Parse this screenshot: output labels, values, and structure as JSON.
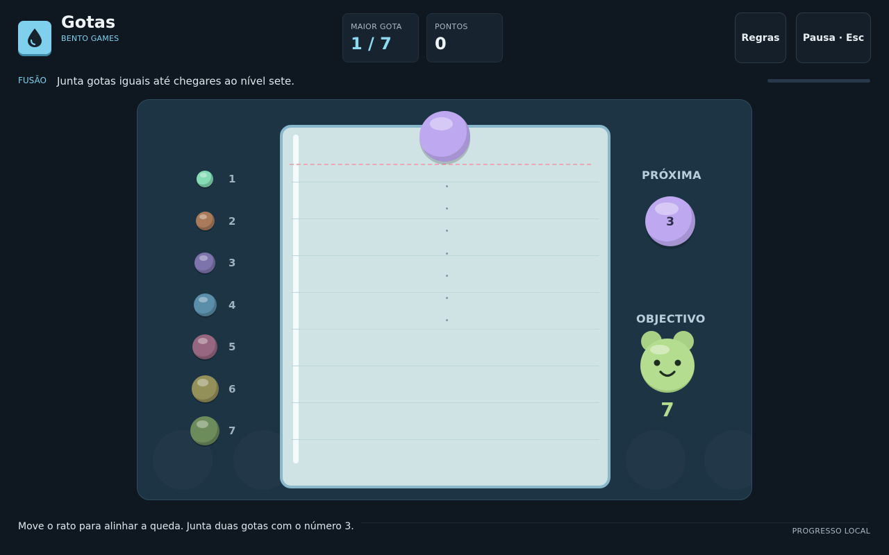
{
  "app": {
    "title": "Gotas",
    "subtitle": "BENTO GAMES",
    "icon": "water-drop-icon"
  },
  "stats": {
    "largest_drop": {
      "label": "MAIOR GOTA",
      "value": "1 / 7"
    },
    "points": {
      "label": "PONTOS",
      "value": "0"
    }
  },
  "header_buttons": {
    "rules": "Regras",
    "pause": "Pausa · Esc"
  },
  "mode": {
    "tag": "FUSÃO",
    "instruction": "Junta gotas iguais até chegares ao nível sete.",
    "progress_fraction": 0
  },
  "legend": [
    {
      "level": "1",
      "color": "#84dbb4"
    },
    {
      "level": "2",
      "color": "#a97b5b"
    },
    {
      "level": "3",
      "color": "#7e74ac"
    },
    {
      "level": "4",
      "color": "#5a8ea9"
    },
    {
      "level": "5",
      "color": "#976782"
    },
    {
      "level": "6",
      "color": "#94905a"
    },
    {
      "level": "7",
      "color": "#6d8c5c"
    }
  ],
  "current_drop": {
    "level": 3,
    "color": "#bea8ef"
  },
  "next": {
    "label": "PRÓXIMA",
    "level": "3",
    "color": "#bea8ef"
  },
  "goal": {
    "label": "OBJECTIVO",
    "level": "7",
    "color": "#b5dd8f",
    "icon": "smiling-drop-icon"
  },
  "footer": {
    "hint": "Move o rato para alinhar a queda. Junta duas gotas com o número 3.",
    "right_label": "PROGRESSO LOCAL"
  }
}
